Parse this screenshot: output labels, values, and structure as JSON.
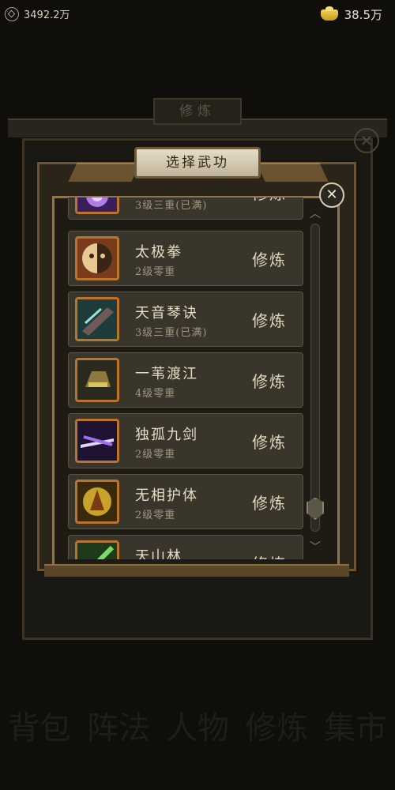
{
  "topbar": {
    "coins": "3492.2万",
    "ingots": "38.5万"
  },
  "background": {
    "panel_title": "修炼",
    "bottom_nav": [
      "背包",
      "阵法",
      "人物",
      "修炼",
      "集市"
    ]
  },
  "dialog": {
    "title": "选择武功",
    "train_label": "修炼",
    "skills": [
      {
        "name": "",
        "level": "3级三重(已满)",
        "icon": "purple-energy-icon"
      },
      {
        "name": "太极拳",
        "level": "2级零重",
        "icon": "taiji-mask-icon"
      },
      {
        "name": "天音琴诀",
        "level": "3级三重(已满)",
        "icon": "qin-strike-icon"
      },
      {
        "name": "一苇渡江",
        "level": "4级零重",
        "icon": "golden-boot-icon"
      },
      {
        "name": "独孤九剑",
        "level": "2级零重",
        "icon": "violet-sword-icon"
      },
      {
        "name": "无相护体",
        "level": "2级零重",
        "icon": "golden-body-icon"
      },
      {
        "name": "天山林",
        "level": "",
        "icon": "green-blade-icon"
      }
    ]
  },
  "colors": {
    "frame": "#8a7651",
    "row_bg": "#3a352b",
    "icon_border": "#b9742e"
  }
}
